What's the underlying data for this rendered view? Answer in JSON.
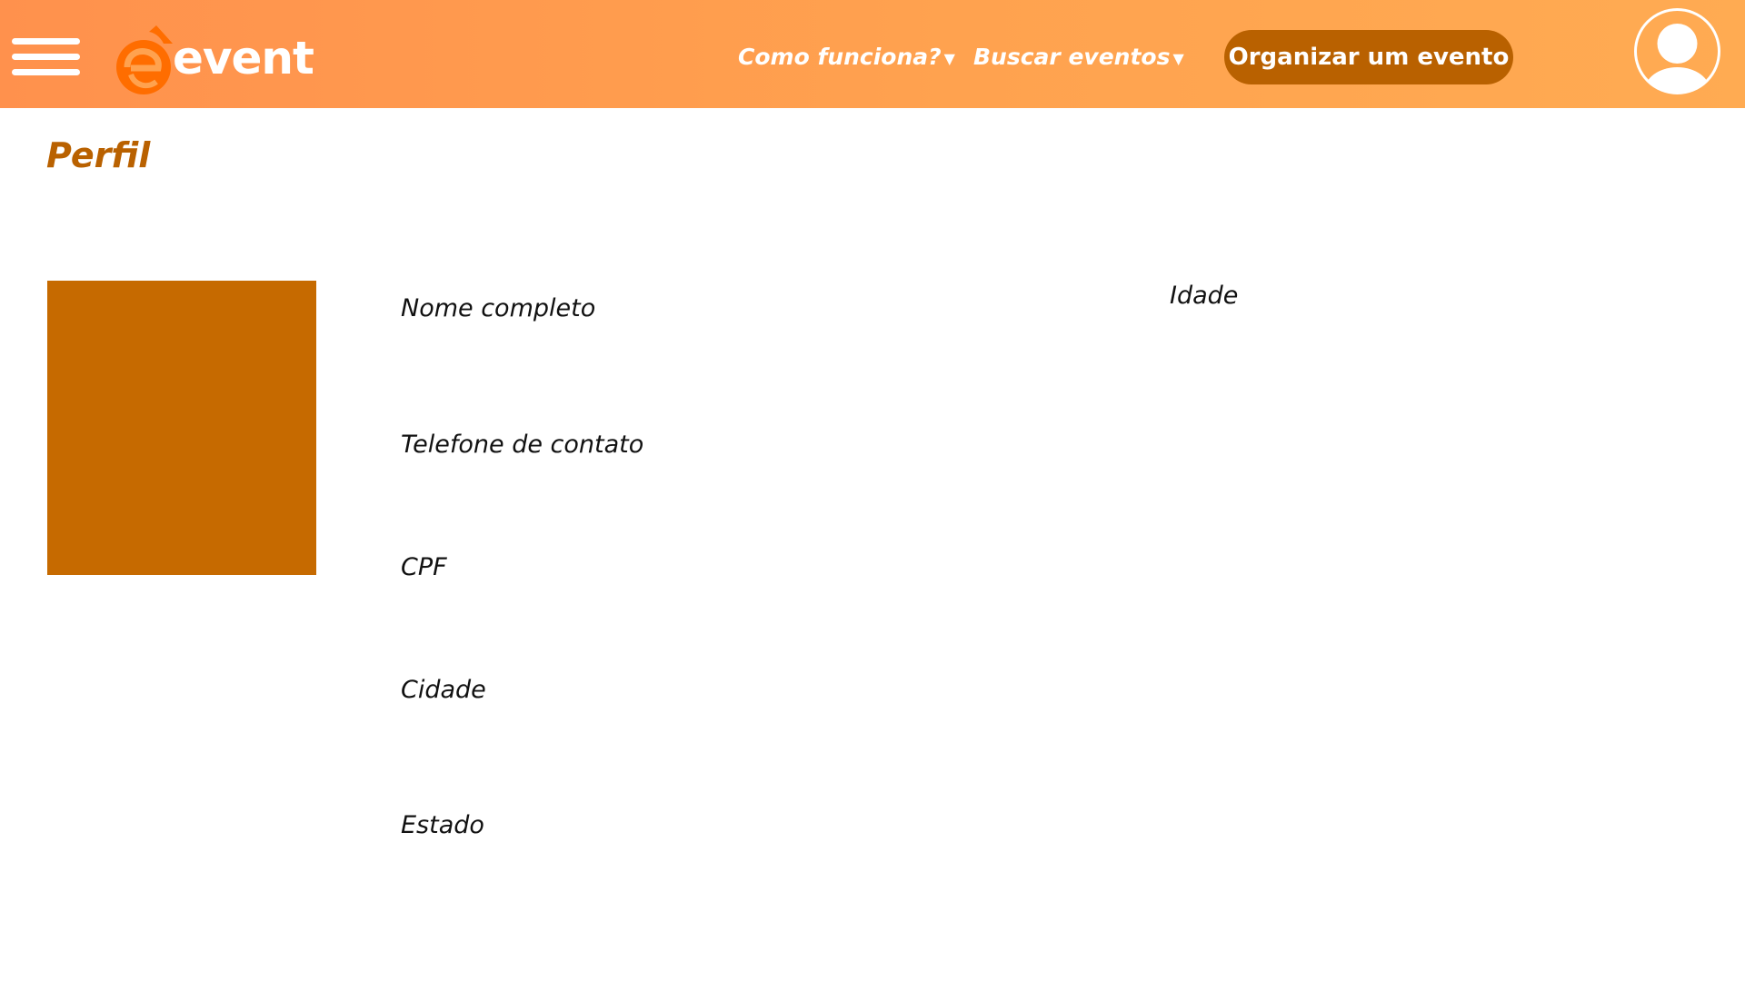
{
  "app": {
    "logo_text": "event",
    "logo_icon": "e-arrow-logo-icon",
    "menu_icon": "hamburger-menu-icon"
  },
  "nav": {
    "items": [
      {
        "label": "Como funciona?",
        "icon": "caret-down-icon"
      },
      {
        "label": "Buscar eventos",
        "icon": "caret-down-icon"
      }
    ],
    "cta_label": "Organizar um evento",
    "avatar_icon": "user-avatar-icon"
  },
  "page": {
    "title": "Perfil"
  },
  "profile": {
    "photo": "profile-photo-placeholder",
    "fields": {
      "nome": "Nome completo",
      "telefone": "Telefone de contato",
      "cpf": "CPF",
      "cidade": "Cidade",
      "estado": "Estado",
      "idade": "Idade"
    }
  },
  "colors": {
    "header_gradient_start": "#ff914d",
    "header_gradient_end": "#ffab52",
    "accent_dark": "#b96100",
    "photo_fill": "#c66a00",
    "logo_orange": "#ff6d00"
  }
}
